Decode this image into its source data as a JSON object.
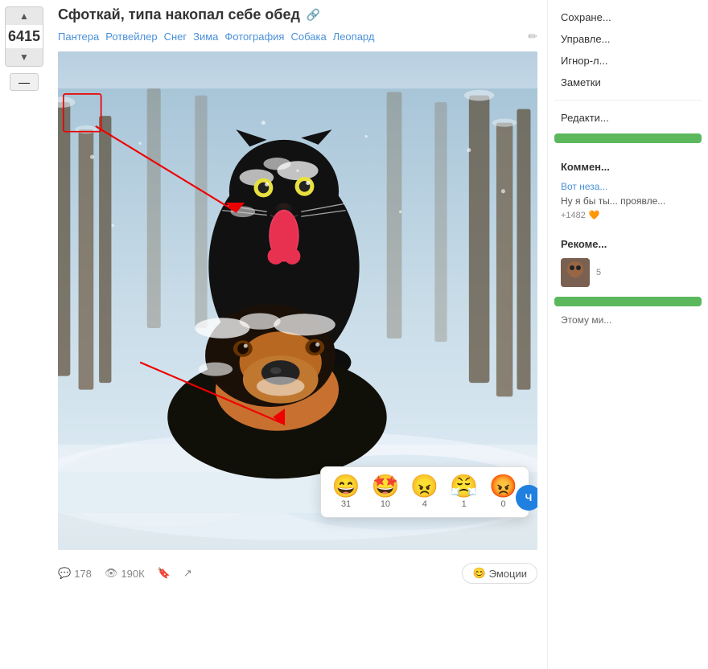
{
  "post": {
    "title": "Сфоткай, типа накопал себе обед",
    "vote_count": "6415",
    "tags": [
      "Пантера",
      "Ротвейлер",
      "Снег",
      "Зима",
      "Фотография",
      "Собака",
      "Леопард"
    ],
    "comments_count": "178",
    "views": "190К",
    "emotions_label": "Эмоции"
  },
  "vote": {
    "up_label": "▲",
    "down_label": "▼",
    "minus_label": "—"
  },
  "emoji_popup": {
    "items": [
      {
        "face": "😄",
        "count": "31"
      },
      {
        "face": "🤩",
        "count": "10"
      },
      {
        "face": "😠",
        "count": "4"
      },
      {
        "face": "😤",
        "count": "1"
      },
      {
        "face": "😡",
        "count": "0"
      }
    ]
  },
  "sidebar": {
    "save_label": "Сохране...",
    "manage_label": "Управле...",
    "ignore_label": "Игнор-л...",
    "notes_label": "Заметки",
    "edit_label": "Редакти...",
    "subscribe_btn": "",
    "comments_title": "Коммен...",
    "comment_link": "Вот неза...",
    "comment_text": "Ну я бы ты... проявле...",
    "comment_votes": "+1482",
    "recommendations_title": "Рекоме...",
    "rec_text": "",
    "rec_count": "5",
    "rec_green_btn": "",
    "about_label": "Этому ми..."
  },
  "icons": {
    "comment": "💬",
    "eye": "👁",
    "save": "🔖",
    "share": "↗",
    "link": "🔗",
    "smile": "😊",
    "emoji_btn": "😊"
  }
}
